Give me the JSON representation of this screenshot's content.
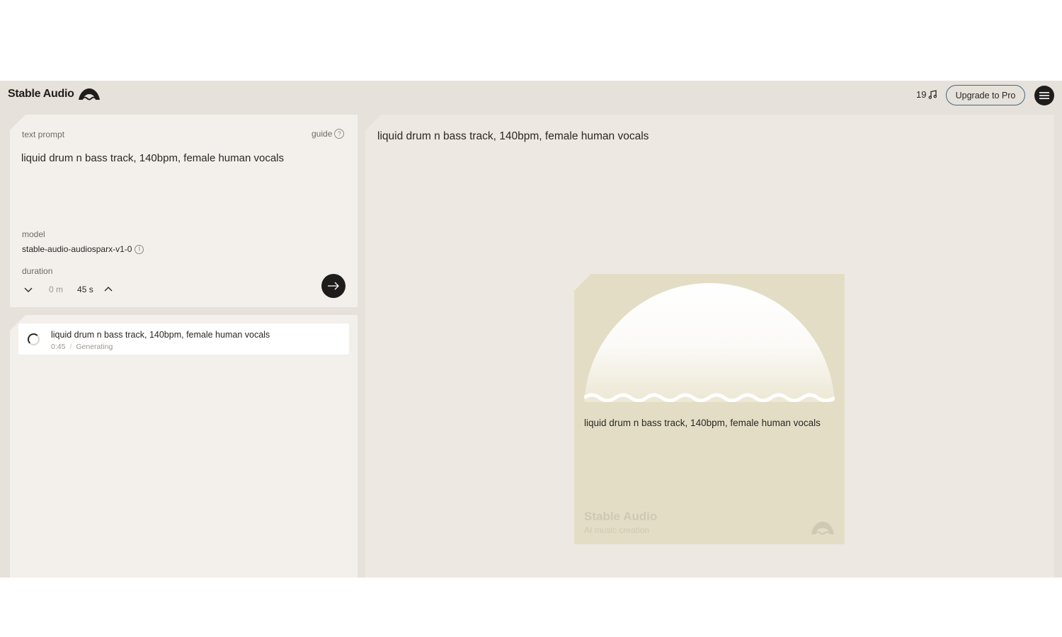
{
  "app": {
    "name": "Stable Audio",
    "credits": "19",
    "upgrade_label": "Upgrade to Pro"
  },
  "icons": {
    "logo": "stable-audio-logo-icon",
    "credits": "music-note-icon",
    "menu": "hamburger-menu-icon",
    "guide": "question-mark-icon",
    "info": "info-icon",
    "duration_down": "chevron-down-icon",
    "duration_up": "chevron-up-icon",
    "generate": "arrow-right-icon",
    "spinner": "loading-spinner-icon"
  },
  "prompt_panel": {
    "text_prompt_label": "text prompt",
    "guide_label": "guide",
    "guide_glyph": "?",
    "prompt_value": "liquid drum n bass track, 140bpm, female human vocals",
    "model_label": "model",
    "model_value": "stable-audio-audiosparx-v1-0",
    "info_glyph": "i",
    "duration_label": "duration",
    "duration_minutes": "0 m",
    "duration_seconds": "45 s"
  },
  "history": [
    {
      "title": "liquid drum n bass track, 140bpm, female human vocals",
      "length": "0:45",
      "separator": "/",
      "status": "Generating"
    }
  ],
  "main": {
    "title": "liquid drum n bass track, 140bpm, female human vocals",
    "artwork": {
      "caption": "liquid drum n bass track, 140bpm, female human vocals",
      "brand": "Stable Audio",
      "tagline": "AI music creation"
    }
  },
  "colors": {
    "background": "#e6e1da",
    "panel": "#f3f0ec",
    "main_panel": "#ede8e2",
    "artwork": "#e3ddc6",
    "dark": "#1f1d1b",
    "upgrade_border": "#3e6b8a"
  }
}
